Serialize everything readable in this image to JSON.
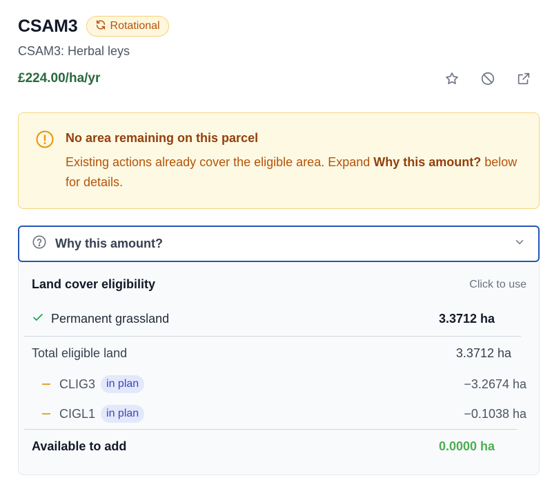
{
  "header": {
    "title": "CSAM3",
    "badge": {
      "label": "Rotational",
      "icon": "refresh-icon"
    },
    "subtitle": "CSAM3: Herbal leys",
    "price": "£224.00/ha/yr",
    "actions": [
      "star-icon",
      "block-icon",
      "external-link-icon"
    ]
  },
  "alert": {
    "title": "No area remaining on this parcel",
    "text_before": "Existing actions already cover the eligible area. Expand ",
    "text_strong": "Why this amount?",
    "text_after": " below for details."
  },
  "why": {
    "label": "Why this amount?"
  },
  "eligibility": {
    "title": "Land cover eligibility",
    "hint": "Click to use",
    "land_covers": [
      {
        "label": "Permanent grassland",
        "value": "3.3712 ha"
      }
    ],
    "total": {
      "label": "Total eligible land",
      "value": "3.3712 ha"
    },
    "deductions": [
      {
        "code": "CLIG3",
        "tag": "in plan",
        "value": "−3.2674 ha"
      },
      {
        "code": "CIGL1",
        "tag": "in plan",
        "value": "−0.1038 ha"
      }
    ],
    "available": {
      "label": "Available to add",
      "value": "0.0000 ha"
    }
  },
  "colors": {
    "price": "#276a3c",
    "badge_text": "#b45309",
    "alert_bg": "#fef9e3",
    "focus_border": "#2557b8",
    "available_value": "#4caf50"
  }
}
